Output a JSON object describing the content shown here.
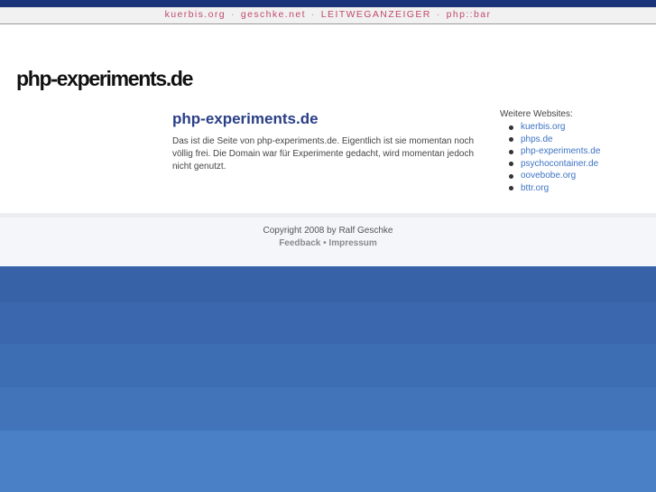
{
  "topnav": {
    "links": [
      "kuerbis.org",
      "geschke.net",
      "LEITWEGANZEIGER",
      "php::bar"
    ],
    "separator": "·"
  },
  "site_title": "php-experiments.de",
  "main": {
    "heading": "php-experiments.de",
    "text": "Das ist die Seite von php-experiments.de. Eigentlich ist sie momentan noch völlig frei. Die Domain war für Experimente gedacht, wird momentan jedoch nicht genutzt."
  },
  "sidebar": {
    "title": "Weitere Websites:",
    "links": [
      "kuerbis.org",
      "phps.de",
      "php-experiments.de",
      "psychocontainer.de",
      "oovebobe.org",
      "bttr.org"
    ]
  },
  "footer": {
    "copyright": "Copyright 2008 by Ralf Geschke",
    "feedback": "Feedback",
    "bullet": "•",
    "impressum": "Impressum"
  },
  "colors": {
    "top_stripe": "#1a3379",
    "nav_link": "#c04a6c",
    "heading": "#2a3f86",
    "sidebar_link": "#3d73c5",
    "bottom_blue": "#3762a8"
  }
}
